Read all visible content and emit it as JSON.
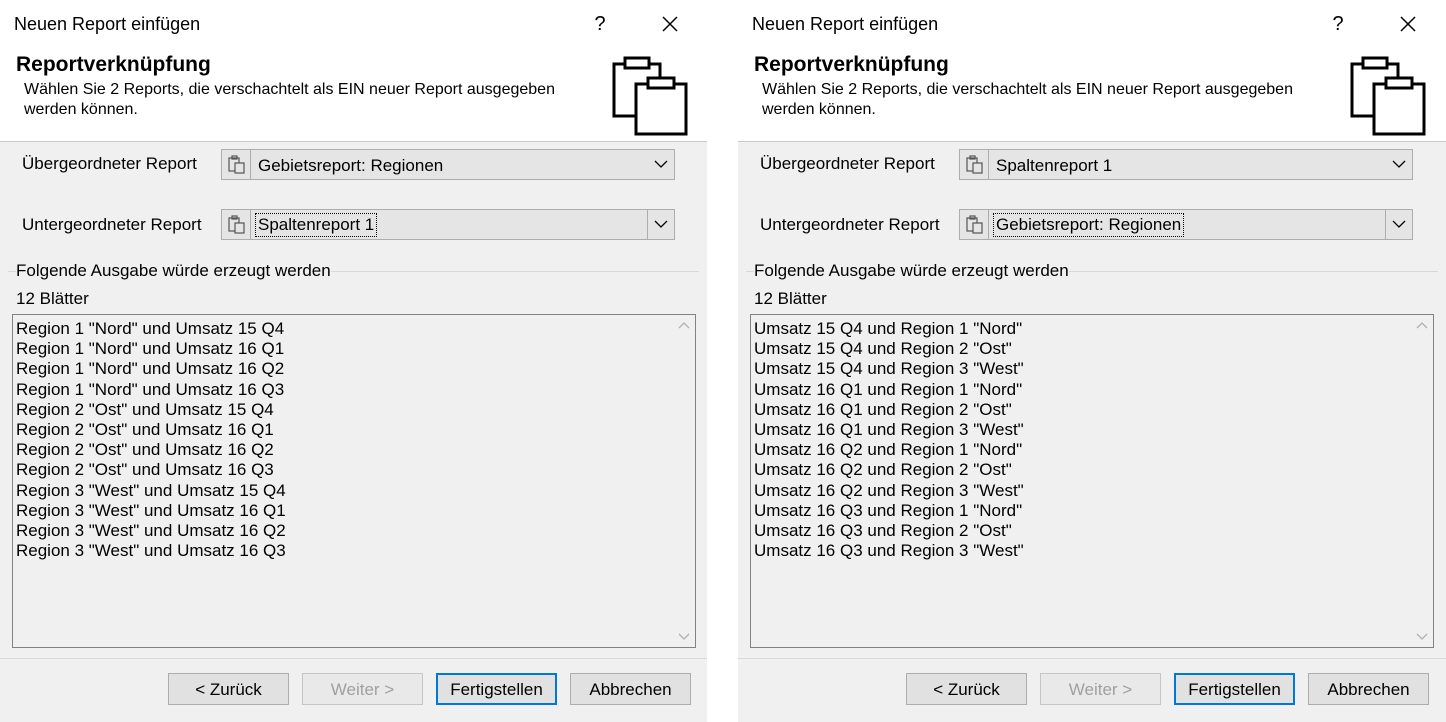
{
  "dialogs": [
    {
      "window_title": "Neuen Report einfügen",
      "help_label": "?",
      "close_label": "✕",
      "header_title": "Reportverknüpfung",
      "header_desc": "Wählen Sie 2 Reports, die verschachtelt als EIN neuer Report ausgegeben werden können.",
      "parent_label": "Übergeordneter Report",
      "parent_value": "Gebietsreport: Regionen",
      "child_label": "Untergeordneter Report",
      "child_value": "Spaltenreport 1",
      "group_label": "Folgende Ausgabe würde erzeugt werden",
      "count_label": "12 Blätter",
      "items": [
        "Region 1 \"Nord\" und Umsatz 15 Q4",
        "Region 1 \"Nord\" und Umsatz 16 Q1",
        "Region 1 \"Nord\" und Umsatz 16 Q2",
        "Region 1 \"Nord\" und Umsatz 16 Q3",
        "Region 2 \"Ost\" und Umsatz 15 Q4",
        "Region 2 \"Ost\" und Umsatz 16 Q1",
        "Region 2 \"Ost\" und Umsatz 16 Q2",
        "Region 2 \"Ost\" und Umsatz 16 Q3",
        "Region 3 \"West\" und Umsatz 15 Q4",
        "Region 3 \"West\" und Umsatz 16 Q1",
        "Region 3 \"West\" und Umsatz 16 Q2",
        "Region 3 \"West\" und Umsatz 16 Q3"
      ],
      "buttons": {
        "back": "< Zurück",
        "next": "Weiter >",
        "finish": "Fertigstellen",
        "cancel": "Abbrechen"
      }
    },
    {
      "window_title": "Neuen Report einfügen",
      "help_label": "?",
      "close_label": "✕",
      "header_title": "Reportverknüpfung",
      "header_desc": "Wählen Sie 2 Reports, die verschachtelt als EIN neuer Report ausgegeben werden können.",
      "parent_label": "Übergeordneter Report",
      "parent_value": "Spaltenreport 1",
      "child_label": "Untergeordneter Report",
      "child_value": "Gebietsreport: Regionen",
      "group_label": "Folgende Ausgabe würde erzeugt werden",
      "count_label": "12 Blätter",
      "items": [
        "Umsatz 15 Q4 und Region 1 \"Nord\"",
        "Umsatz 15 Q4 und Region 2 \"Ost\"",
        "Umsatz 15 Q4 und Region 3 \"West\"",
        "Umsatz 16 Q1 und Region 1 \"Nord\"",
        "Umsatz 16 Q1 und Region 2 \"Ost\"",
        "Umsatz 16 Q1 und Region 3 \"West\"",
        "Umsatz 16 Q2 und Region 1 \"Nord\"",
        "Umsatz 16 Q2 und Region 2 \"Ost\"",
        "Umsatz 16 Q2 und Region 3 \"West\"",
        "Umsatz 16 Q3 und Region 1 \"Nord\"",
        "Umsatz 16 Q3 und Region 2 \"Ost\"",
        "Umsatz 16 Q3 und Region 3 \"West\""
      ],
      "buttons": {
        "back": "< Zurück",
        "next": "Weiter >",
        "finish": "Fertigstellen",
        "cancel": "Abbrechen"
      }
    }
  ],
  "colors": {
    "dialog_bg": "#f0f0f0",
    "header_bg": "#ffffff",
    "default_button_border": "#0078d7",
    "disabled_text": "#a0a0a0"
  }
}
